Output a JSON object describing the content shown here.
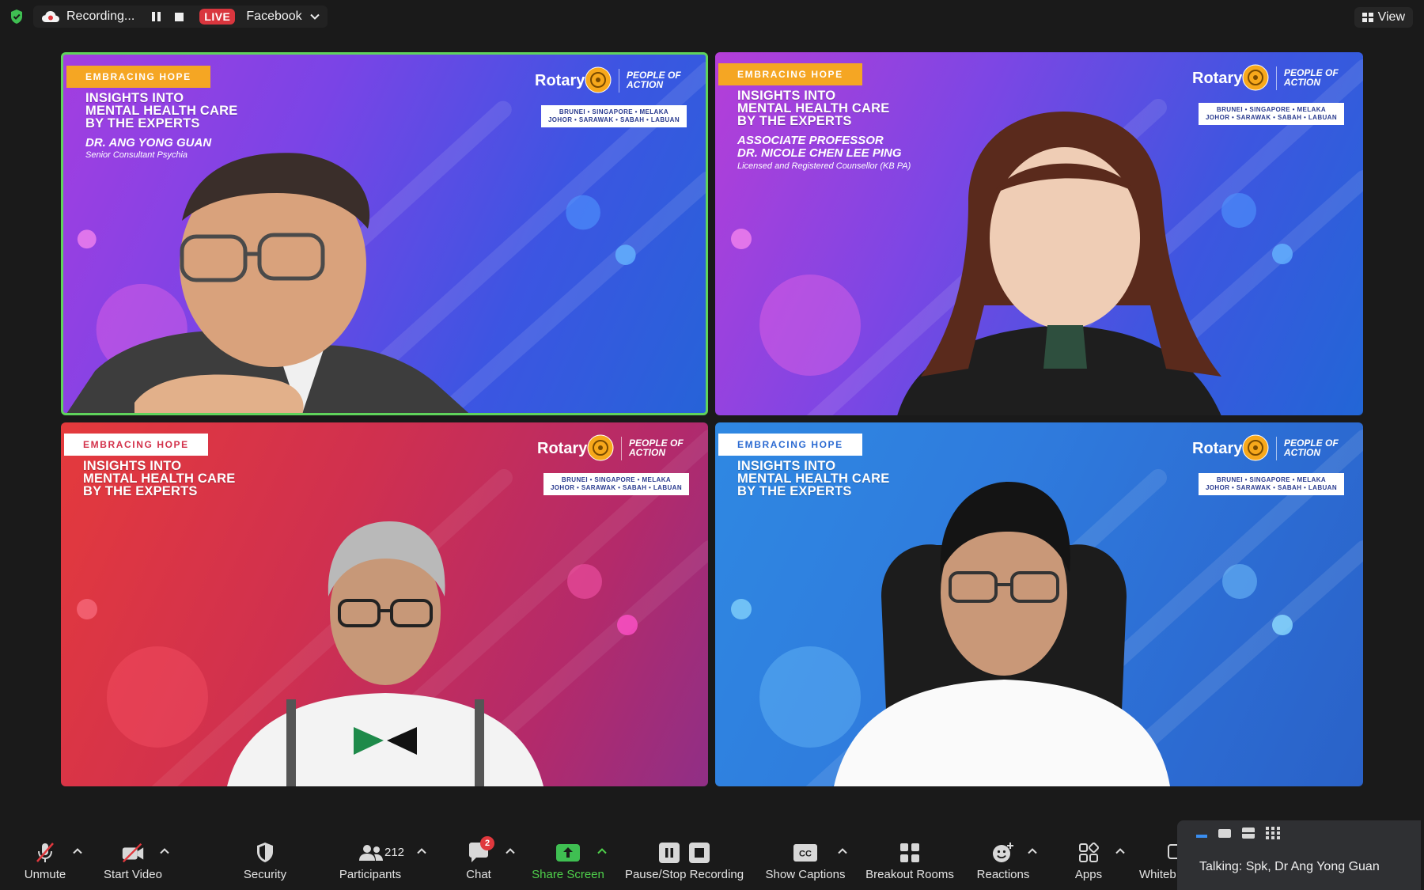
{
  "topbar": {
    "recording_text": "Recording...",
    "live_label": "LIVE",
    "stream_target": "Facebook",
    "view_label": "View"
  },
  "tiles": [
    {
      "tag": "EMBRACING HOPE",
      "headline": [
        "INSIGHTS INTO",
        "MENTAL HEALTH CARE",
        "BY THE EXPERTS"
      ],
      "speaker": [
        "DR. ANG YONG GUAN"
      ],
      "speaker_sub": "Senior Consultant Psychia",
      "rotary": "Rotary",
      "people_of_action": [
        "PEOPLE OF",
        "ACTION"
      ],
      "regions": [
        "BRUNEI • SINGAPORE • MELAKA",
        "JOHOR • SARAWAK • SABAH • LABUAN"
      ],
      "active_speaker": true
    },
    {
      "tag": "EMBRACING HOPE",
      "headline": [
        "INSIGHTS INTO",
        "MENTAL HEALTH CARE",
        "BY THE EXPERTS"
      ],
      "speaker": [
        "ASSOCIATE PROFESSOR",
        "DR. NICOLE CHEN LEE PING"
      ],
      "speaker_sub": "Licensed and Registered Counsellor (KB PA)",
      "rotary": "Rotary",
      "people_of_action": [
        "PEOPLE OF",
        "ACTION"
      ],
      "regions": [
        "BRUNEI • SINGAPORE • MELAKA",
        "JOHOR • SARAWAK • SABAH • LABUAN"
      ]
    },
    {
      "tag": "EMBRACING HOPE",
      "headline": [
        "INSIGHTS INTO",
        "MENTAL HEALTH CARE",
        "BY THE EXPERTS"
      ],
      "rotary": "Rotary",
      "people_of_action": [
        "PEOPLE OF",
        "ACTION"
      ],
      "regions": [
        "BRUNEI • SINGAPORE • MELAKA",
        "JOHOR • SARAWAK • SABAH • LABUAN"
      ]
    },
    {
      "tag": "EMBRACING HOPE",
      "headline": [
        "INSIGHTS INTO",
        "MENTAL HEALTH CARE",
        "BY THE EXPERTS"
      ],
      "rotary": "Rotary",
      "people_of_action": [
        "PEOPLE OF",
        "ACTION"
      ],
      "regions": [
        "BRUNEI • SINGAPORE • MELAKA",
        "JOHOR • SARAWAK • SABAH • LABUAN"
      ]
    }
  ],
  "toolbar": {
    "unmute": "Unmute",
    "start_video": "Start Video",
    "security": "Security",
    "participants": "Participants",
    "participant_count": "212",
    "chat": "Chat",
    "chat_badge": "2",
    "share_screen": "Share Screen",
    "pause_stop_recording": "Pause/Stop Recording",
    "show_captions": "Show Captions",
    "breakout_rooms": "Breakout Rooms",
    "reactions": "Reactions",
    "apps": "Apps",
    "whiteboards": "Whiteb"
  },
  "talking": {
    "text": "Talking: Spk, Dr Ang Yong Guan"
  },
  "colors": {
    "active_border": "#5fd35c",
    "live": "#d9363e",
    "share_green": "#4fd14b",
    "badge_red": "#e0383d"
  }
}
